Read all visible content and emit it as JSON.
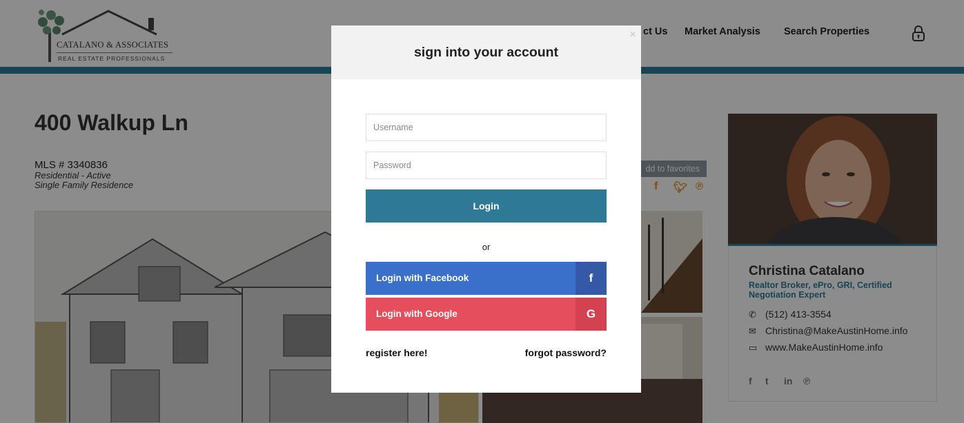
{
  "header": {
    "logo": {
      "name": "CATALANO & ASSOCIATES",
      "tagline": "REAL ESTATE PROFESSIONALS"
    },
    "nav": [
      "ct Us",
      "Market Analysis",
      "Search Properties"
    ],
    "login_icon": "lock-icon",
    "accent_color": "#2a7f99"
  },
  "listing": {
    "address": "400 Walkup Ln",
    "mls": "MLS # 3340836",
    "status": "Residential - Active",
    "subtype": "Single Family Residence",
    "favorites_label": "dd to favorites",
    "share_icons": [
      "facebook-icon",
      "twitter-icon",
      "pinterest-icon"
    ]
  },
  "agent": {
    "name": "Christina Catalano",
    "title": "Realtor Broker, ePro, GRI, Certified Negotiation Expert",
    "phone": "(512) 413-3554",
    "email": "Christina@MakeAustinHome.info",
    "website": "www.MakeAustinHome.info",
    "social": [
      "facebook-icon",
      "twitter-icon",
      "linkedin-icon",
      "pinterest-icon"
    ]
  },
  "modal": {
    "title": "sign into your account",
    "close": "×",
    "username_placeholder": "Username",
    "password_placeholder": "Password",
    "login_label": "Login",
    "or_label": "or",
    "facebook_label": "Login with Facebook",
    "facebook_glyph": "f",
    "google_label": "Login with Google",
    "google_glyph": "G",
    "register_label": "register here!",
    "forgot_label": "forgot password?",
    "colors": {
      "login": "#2e7a96",
      "facebook": "#3a6fca",
      "google": "#e54e5c"
    }
  }
}
